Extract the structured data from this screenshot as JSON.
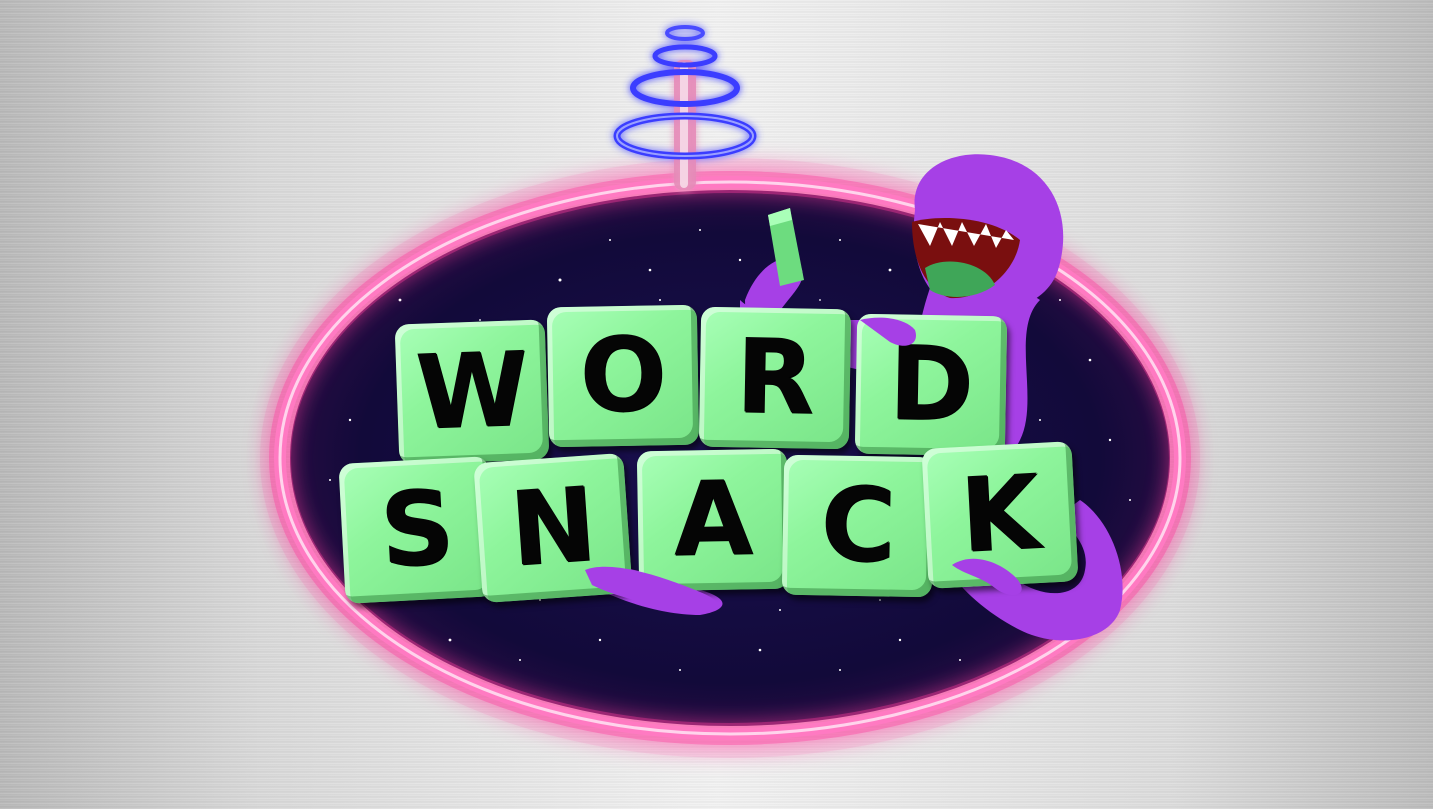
{
  "logo": {
    "word_row": [
      "W",
      "O",
      "R",
      "D"
    ],
    "snack_row": [
      "S",
      "N",
      "A",
      "C",
      "K"
    ]
  },
  "colors": {
    "neon_ring": "#ff3c9e",
    "space": "#120a3a",
    "tile_green": "#8ef59c",
    "creature_purple": "#a640e6",
    "antenna_blue": "#3a3cff",
    "metal": "#d8d8d8"
  },
  "icons": {
    "antenna": "neon-antenna-icon",
    "creature": "purple-monster-icon"
  }
}
